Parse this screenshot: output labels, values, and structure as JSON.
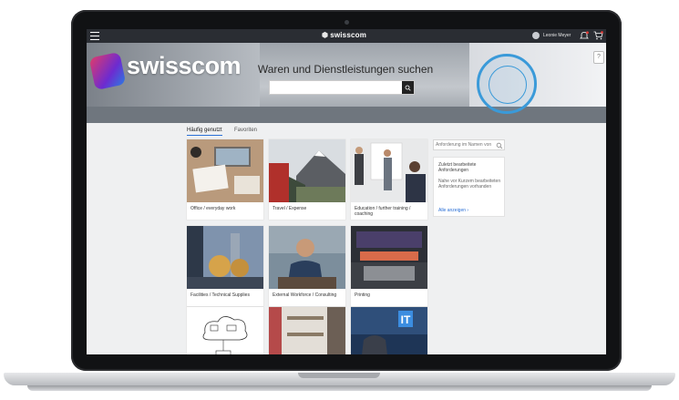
{
  "header": {
    "brand": "swisscom",
    "user_name": "Leonie Meyer"
  },
  "hero": {
    "brand_text": "swisscom",
    "title": "Waren und Dienstleistungen suchen",
    "search_placeholder": ""
  },
  "tabs": [
    {
      "label": "Häufig genutzt",
      "active": true
    },
    {
      "label": "Favoriten",
      "active": false
    }
  ],
  "tiles": [
    {
      "label": "Office / everyday work"
    },
    {
      "label": "Travel / Expense"
    },
    {
      "label": "Education / further training / coaching"
    },
    {
      "label": "Facilities / Technical Supplies"
    },
    {
      "label": "External Workforce / Consulting"
    },
    {
      "label": "Printing"
    },
    {
      "label": ""
    },
    {
      "label": ""
    },
    {
      "label": ""
    }
  ],
  "side_panel": {
    "search_placeholder": "Anforderung im Namen von",
    "heading": "Zuletzt bearbeitete Anforderungen",
    "text": "Nahe vor Kurzem bearbeiteten Anforderungen vorhanden",
    "link": "Alle anzeigen"
  },
  "colors": {
    "topbar": "#2a2d33",
    "accent": "#2a6fd6",
    "stamp": "#3a9ad9"
  }
}
